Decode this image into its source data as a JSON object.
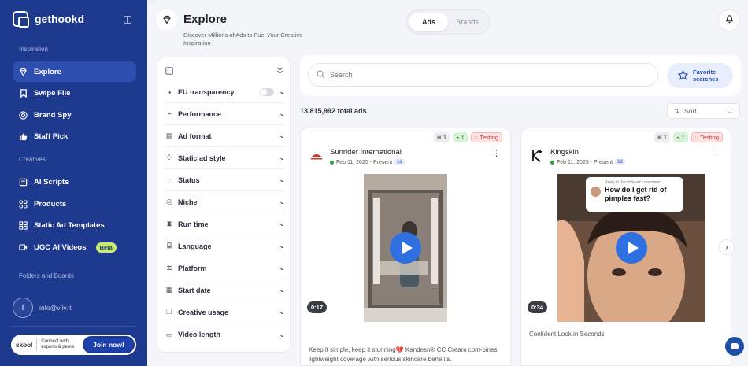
{
  "app": {
    "name": "gethookd"
  },
  "sidebar": {
    "sections": {
      "inspiration": "Inspiration",
      "creatives": "Creatives",
      "folders": "Folders and Boards"
    },
    "items": [
      {
        "label": "Explore",
        "icon": "gem-icon",
        "active": true
      },
      {
        "label": "Swipe File",
        "icon": "bookmark-icon"
      },
      {
        "label": "Brand Spy",
        "icon": "target-icon"
      },
      {
        "label": "Staff Pick",
        "icon": "thumbs-up-icon"
      },
      {
        "label": "AI Scripts",
        "icon": "document-icon"
      },
      {
        "label": "Products",
        "icon": "grid-icon"
      },
      {
        "label": "Static Ad Templates",
        "icon": "image-icon"
      },
      {
        "label": "UGC AI Videos",
        "icon": "video-icon",
        "badge": "Beta"
      }
    ],
    "account": {
      "initial": "I",
      "email": "info@viiv.lt"
    },
    "skool": {
      "logo": "skool",
      "text": "Connect with experts & peers",
      "cta": "Join now!"
    }
  },
  "header": {
    "title": "Explore",
    "subtitle": "Discover Millions of Ads to Fuel Your Creative Inspiration",
    "tabs": [
      {
        "label": "Ads",
        "active": true
      },
      {
        "label": "Brands",
        "active": false
      }
    ]
  },
  "filters": [
    {
      "label": "EU transparency",
      "icon": "globe-icon",
      "toggle": true
    },
    {
      "label": "Performance",
      "icon": "chart-icon"
    },
    {
      "label": "Ad format",
      "icon": "format-icon"
    },
    {
      "label": "Static ad style",
      "icon": "layout-icon"
    },
    {
      "label": "Status",
      "icon": "loader-icon"
    },
    {
      "label": "Niche",
      "icon": "target-icon"
    },
    {
      "label": "Run time",
      "icon": "hourglass-icon"
    },
    {
      "label": "Language",
      "icon": "translate-icon"
    },
    {
      "label": "Platform",
      "icon": "layers-icon"
    },
    {
      "label": "Start date",
      "icon": "calendar-icon"
    },
    {
      "label": "Creative usage",
      "icon": "copy-icon"
    },
    {
      "label": "Video length",
      "icon": "video-icon"
    }
  ],
  "search": {
    "placeholder": "Search",
    "favorite_label_1": "Favorite",
    "favorite_label_2": "searches"
  },
  "results": {
    "total": "13,815,992 total ads",
    "sort_label": "Sort"
  },
  "ads": [
    {
      "advertiser": "Sunrider International",
      "date": "Feb 11, 2025 - Present",
      "age": "1d",
      "badges": {
        "count_a": "1",
        "count_b": "1",
        "status": "Testing"
      },
      "duration": "0:17",
      "caption": "Keep it simple, keep it stunning💔 Kandesn® CC Cream com-bines lightweight coverage with serious skincare benefits."
    },
    {
      "advertiser": "Kingskin",
      "date": "Feb 11, 2025 - Present",
      "age": "1d",
      "badges": {
        "count_a": "1",
        "count_b": "1",
        "status": "Testing"
      },
      "duration": "0:34",
      "reply_to": "Reply to JacobSparr's comment",
      "bubble": "How do I get rid of pimples fast?",
      "caption": "Confident Look in Seconds"
    }
  ],
  "colors": {
    "brand": "#1e3a8f",
    "accent": "#2f6fe0",
    "beta": "#c9ec6a"
  }
}
